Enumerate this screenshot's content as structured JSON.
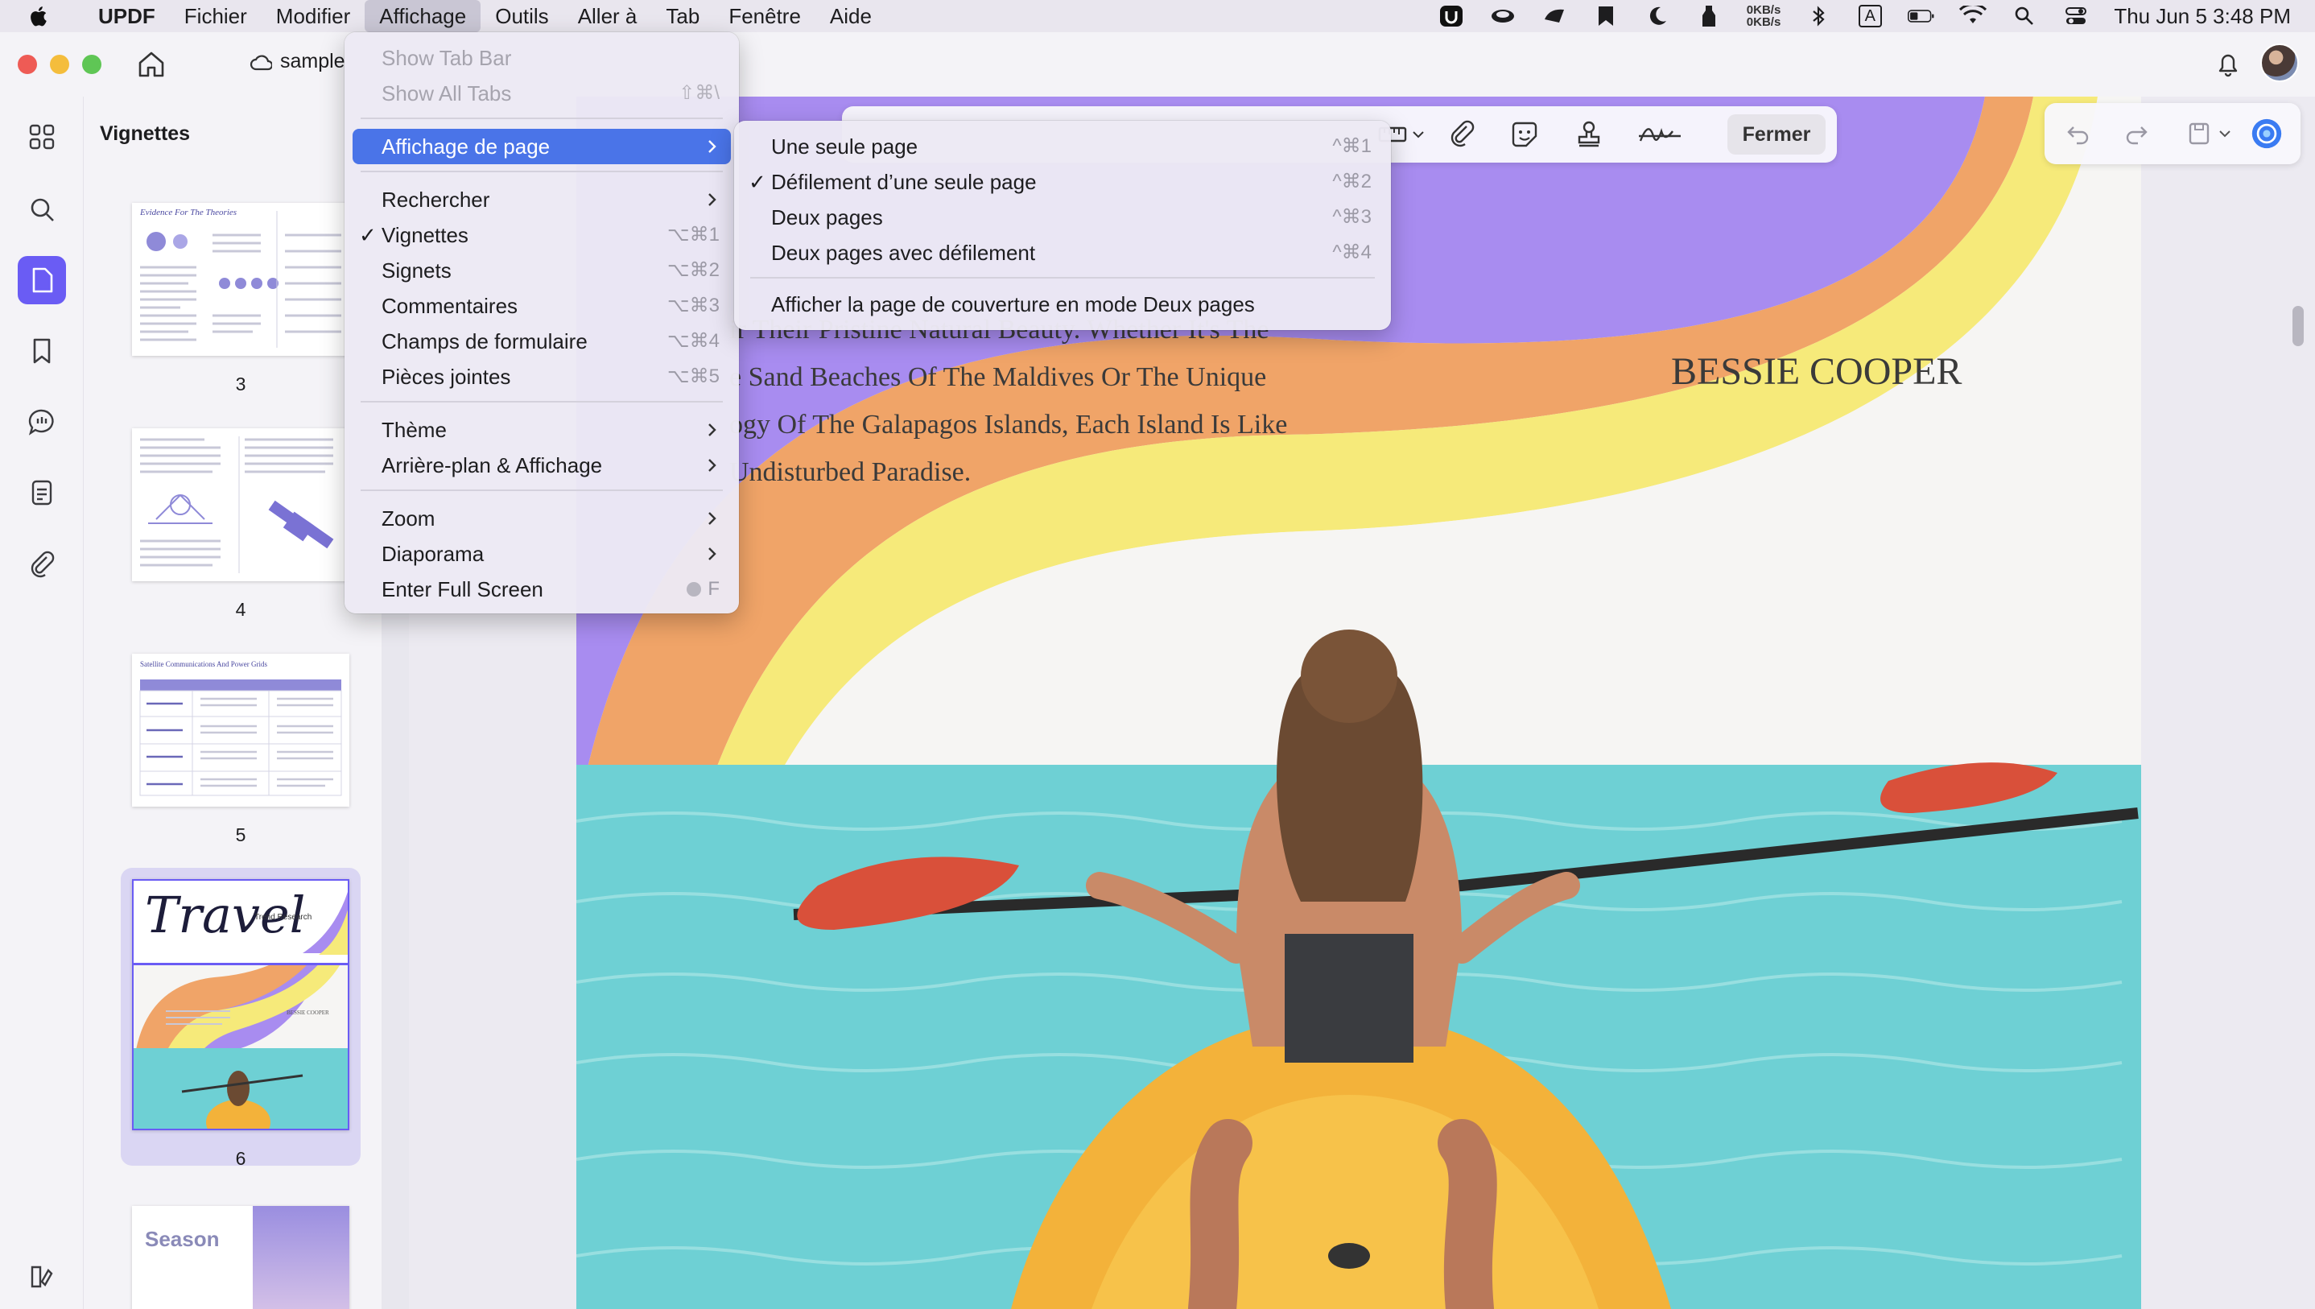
{
  "menubar": {
    "app_name": "UPDF",
    "items": [
      "Fichier",
      "Modifier",
      "Affichage",
      "Outils",
      "Aller à",
      "Tab",
      "Fenêtre",
      "Aide"
    ],
    "net_up": "0KB/s",
    "net_down": "0KB/s",
    "keyboard_label": "A",
    "clock": "Thu Jun 5  3:48 PM"
  },
  "window": {
    "tab_title": "sample"
  },
  "sidebar": {
    "panel_title": "Vignettes",
    "thumbnails": [
      {
        "page": "3",
        "heading": "Evidence For The Theories"
      },
      {
        "page": "4",
        "heading": ""
      },
      {
        "page": "5",
        "heading": "Satellite Communications And Power Grids"
      },
      {
        "page": "6",
        "heading": "Travel",
        "subheading": "Trend Research",
        "author": "BESSIE COOPER"
      },
      {
        "page": "",
        "heading": "Season"
      }
    ],
    "selected_page": "6"
  },
  "toolbar": {
    "close_label": "Fermer"
  },
  "document": {
    "lines": [
      "ir Their Pristine Natural Beauty. Whether It's The",
      "e Sand Beaches Of The Maldives Or The Unique",
      "ogy Of The Galapagos Islands, Each Island Is Like",
      "Undisturbed Paradise."
    ],
    "author": "BESSIE COOPER"
  },
  "view_menu": {
    "items": [
      {
        "label": "Show Tab Bar",
        "shortcut": "",
        "disabled": true
      },
      {
        "label": "Show All Tabs",
        "shortcut": "⇧⌘\\",
        "disabled": true
      },
      {
        "label": "Affichage de page",
        "submenu": true,
        "highlighted": true
      },
      {
        "label": "Rechercher",
        "submenu": true
      },
      {
        "label": "Vignettes",
        "shortcut": "⌥⌘1",
        "checked": true
      },
      {
        "label": "Signets",
        "shortcut": "⌥⌘2"
      },
      {
        "label": "Commentaires",
        "shortcut": "⌥⌘3"
      },
      {
        "label": "Champs de formulaire",
        "shortcut": "⌥⌘4"
      },
      {
        "label": "Pièces jointes",
        "shortcut": "⌥⌘5"
      },
      {
        "label": "Thème",
        "submenu": true
      },
      {
        "label": "Arrière-plan & Affichage",
        "submenu": true
      },
      {
        "label": "Zoom",
        "submenu": true
      },
      {
        "label": "Diaporama",
        "submenu": true
      },
      {
        "label": "Enter Full Screen",
        "shortcut": "F"
      }
    ]
  },
  "page_display_submenu": {
    "items": [
      {
        "label": "Une seule page",
        "shortcut": "^⌘1"
      },
      {
        "label": "Défilement d’une seule page",
        "shortcut": "^⌘2",
        "checked": true
      },
      {
        "label": "Deux pages",
        "shortcut": "^⌘3"
      },
      {
        "label": "Deux pages avec défilement",
        "shortcut": "^⌘4"
      },
      {
        "label": "Afficher la page de couverture en mode Deux pages",
        "shortcut": ""
      }
    ]
  },
  "colors": {
    "accent": "#6a5cf4",
    "menu_highlight": "#4a74e8",
    "rainbow_purple": "#a88cf0",
    "rainbow_orange": "#f0a468",
    "rainbow_yellow": "#f6ea7a",
    "sea": "#6ed0d4"
  },
  "checkmark": "✓"
}
